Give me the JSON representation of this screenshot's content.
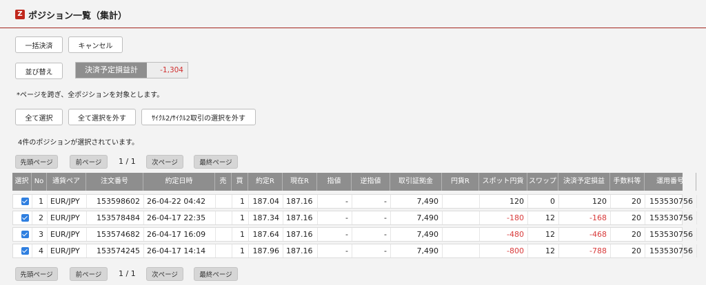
{
  "header": {
    "logo_letter": "Z",
    "title": "ポジション一覧（集計）"
  },
  "actions": {
    "bulk_settle": "一括決済",
    "cancel": "キャンセル",
    "sort": "並び替え"
  },
  "pl_summary": {
    "label": "決済予定損益計",
    "value": "-1,304"
  },
  "note": "*ページを跨ぎ、全ポジションを対象とします。",
  "selection": {
    "select_all": "全て選択",
    "deselect_all": "全て選択を外す",
    "deselect_cycle": "ｻｲｸﾙ2/ｻｲｸﾙ2取引の選択を外す"
  },
  "selected_message": "4件のポジションが選択されています。",
  "pagination": {
    "first": "先頭ページ",
    "prev": "前ページ",
    "page_info": "1 / 1",
    "next": "次ページ",
    "last": "最終ページ"
  },
  "table": {
    "columns": [
      "選択",
      "No",
      "通貨ペア",
      "注文番号",
      "約定日時",
      "売",
      "買",
      "約定R",
      "現在R",
      "指値",
      "逆指値",
      "取引証拠金",
      "円貨R",
      "スポット円貨",
      "スワップ",
      "決済予定損益",
      "手数料等",
      "運用番号"
    ],
    "rows": [
      {
        "checked": true,
        "no": "1",
        "pair": "EUR/JPY",
        "order": "153598602",
        "datetime": "26-04-22 04:42",
        "sell": "",
        "buy": "1",
        "exec_rate": "187.04",
        "cur_rate": "187.16",
        "limit": "-",
        "stop": "-",
        "margin": "7,490",
        "yen_rate": "",
        "spot": "120",
        "swap": "0",
        "pl": "120",
        "fee": "20",
        "op_no": "153530756"
      },
      {
        "checked": true,
        "no": "2",
        "pair": "EUR/JPY",
        "order": "153578484",
        "datetime": "26-04-17 22:35",
        "sell": "",
        "buy": "1",
        "exec_rate": "187.34",
        "cur_rate": "187.16",
        "limit": "-",
        "stop": "-",
        "margin": "7,490",
        "yen_rate": "",
        "spot": "-180",
        "swap": "12",
        "pl": "-168",
        "fee": "20",
        "op_no": "153530756"
      },
      {
        "checked": true,
        "no": "3",
        "pair": "EUR/JPY",
        "order": "153574682",
        "datetime": "26-04-17 16:09",
        "sell": "",
        "buy": "1",
        "exec_rate": "187.64",
        "cur_rate": "187.16",
        "limit": "-",
        "stop": "-",
        "margin": "7,490",
        "yen_rate": "",
        "spot": "-480",
        "swap": "12",
        "pl": "-468",
        "fee": "20",
        "op_no": "153530756"
      },
      {
        "checked": true,
        "no": "4",
        "pair": "EUR/JPY",
        "order": "153574245",
        "datetime": "26-04-17 14:14",
        "sell": "",
        "buy": "1",
        "exec_rate": "187.96",
        "cur_rate": "187.16",
        "limit": "-",
        "stop": "-",
        "margin": "7,490",
        "yen_rate": "",
        "spot": "-800",
        "swap": "12",
        "pl": "-788",
        "fee": "20",
        "op_no": "153530756"
      }
    ]
  },
  "colors": {
    "brand_red": "#c0271c",
    "header_gray": "#8e8e8e",
    "negative": "#d83a3a",
    "checkbox_blue": "#2f7fe0"
  }
}
